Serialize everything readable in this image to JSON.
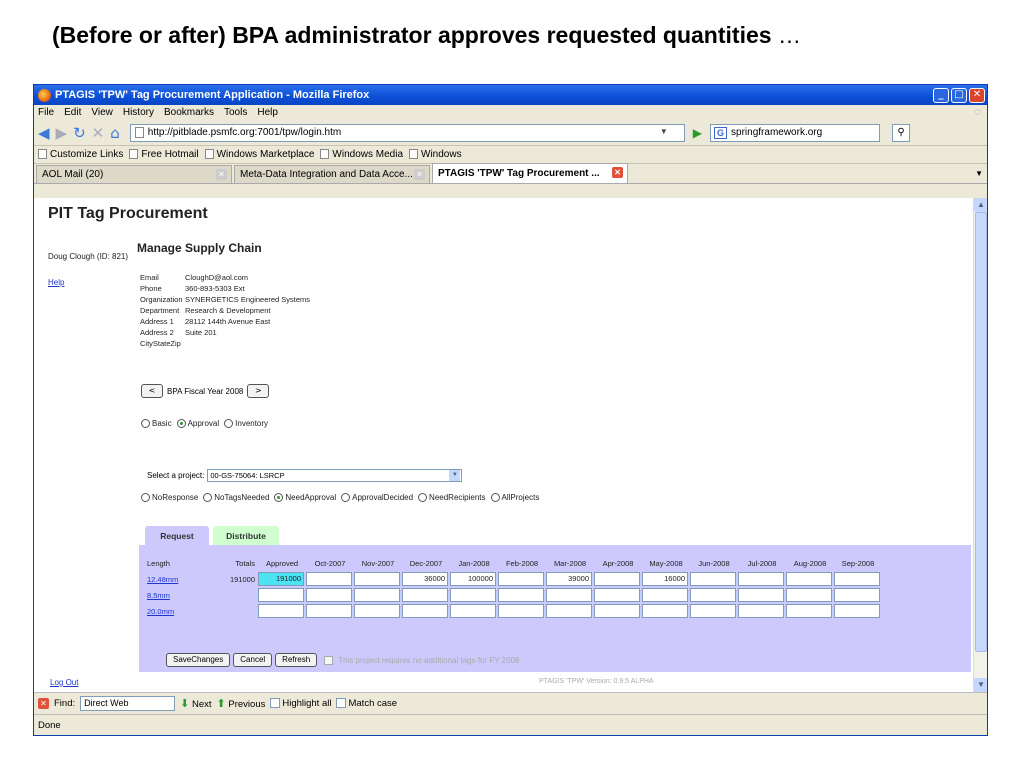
{
  "slide": {
    "title": "(Before or after) BPA administrator approves requested quantities",
    "ellipsis": "…"
  },
  "browser": {
    "window_title": "PTAGIS 'TPW' Tag Procurement Application - Mozilla Firefox",
    "menu": [
      "File",
      "Edit",
      "View",
      "History",
      "Bookmarks",
      "Tools",
      "Help"
    ],
    "url": "http://pitblade.psmfc.org:7001/tpw/login.htm",
    "search_value": "springframework.org",
    "bookmarks": [
      "Customize Links",
      "Free Hotmail",
      "Windows Marketplace",
      "Windows Media",
      "Windows"
    ],
    "tabs": [
      {
        "label": "AOL Mail (20)",
        "active": false
      },
      {
        "label": "Meta-Data Integration and Data Acce...",
        "active": false
      },
      {
        "label": "PTAGIS 'TPW' Tag Procurement ...",
        "active": true
      }
    ],
    "find": {
      "label": "Find:",
      "value": "Direct Web",
      "next": "Next",
      "previous": "Previous",
      "highlight_all": "Highlight all",
      "match_case": "Match case"
    },
    "status": "Done"
  },
  "app": {
    "title": "PIT Tag Procurement",
    "user": "Doug Clough (ID: 821)",
    "help_link": "Help",
    "logout_link": "Log Out",
    "section_title": "Manage Supply Chain",
    "contact": [
      {
        "label": "Email",
        "value": "CloughD@aol.com"
      },
      {
        "label": "Phone",
        "value": "360-893-5303 Ext"
      },
      {
        "label": "Organization",
        "value": "SYNERGETICS Engineered Systems"
      },
      {
        "label": "Department",
        "value": "Research & Development"
      },
      {
        "label": "Address 1",
        "value": "28112 144th Avenue East"
      },
      {
        "label": "Address 2",
        "value": "Suite 201"
      },
      {
        "label": "CityStateZip",
        "value": ""
      }
    ],
    "fiscal_year": {
      "prev": "<",
      "label": "BPA Fiscal Year 2008",
      "next": ">"
    },
    "view_modes": {
      "options": [
        "Basic",
        "Approval",
        "Inventory"
      ],
      "selected": "Approval"
    },
    "project": {
      "label": "Select a project:",
      "value": "00-GS-75064: LSRCP"
    },
    "filters": {
      "options": [
        "NoResponse",
        "NoTagsNeeded",
        "NeedApproval",
        "ApprovalDecided",
        "NeedRecipients",
        "AllProjects"
      ],
      "selected": "NeedApproval"
    },
    "subtabs": {
      "request": "Request",
      "distribute": "Distribute"
    },
    "table": {
      "headers": {
        "length": "Length",
        "totals": "Totals",
        "approved": "Approved"
      },
      "months": [
        "Oct-2007",
        "Nov-2007",
        "Dec-2007",
        "Jan-2008",
        "Feb-2008",
        "Mar-2008",
        "Apr-2008",
        "May-2008",
        "Jun-2008",
        "Jul-2008",
        "Aug-2008",
        "Sep-2008"
      ],
      "rows": [
        {
          "length": "12.48mm",
          "total": "191000",
          "approved": "191000",
          "months": [
            "",
            "",
            "36000",
            "100000",
            "",
            "39000",
            "",
            "16000",
            "",
            "",
            "",
            ""
          ]
        },
        {
          "length": "8.5mm",
          "total": "",
          "approved": "",
          "months": [
            "",
            "",
            "",
            "",
            "",
            "",
            "",
            "",
            "",
            "",
            "",
            ""
          ]
        },
        {
          "length": "20.0mm",
          "total": "",
          "approved": "",
          "months": [
            "",
            "",
            "",
            "",
            "",
            "",
            "",
            "",
            "",
            "",
            "",
            ""
          ]
        }
      ]
    },
    "buttons": {
      "save": "SaveChanges",
      "cancel": "Cancel",
      "refresh": "Refresh"
    },
    "no_tags_text": "This project requires no additional tags for FY 2008",
    "version": "PTAGIS 'TPW' Version: 0.9.5 ALPHA"
  }
}
